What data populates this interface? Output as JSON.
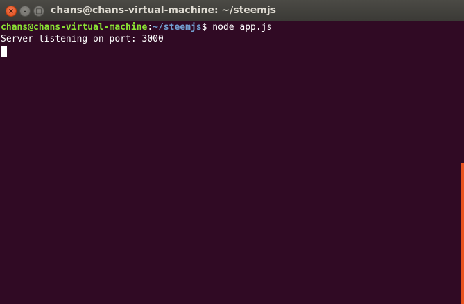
{
  "window": {
    "title": "chans@chans-virtual-machine: ~/steemjs",
    "controls": {
      "close_glyph": "×",
      "minimize_glyph": "–",
      "maximize_glyph": "□"
    }
  },
  "terminal": {
    "prompt": {
      "user_host": "chans@chans-virtual-machine",
      "separator": ":",
      "path": "~/steemjs",
      "symbol": "$",
      "command": " node app.js"
    },
    "output_lines": [
      "Server listening on port: 3000"
    ]
  },
  "colors": {
    "background": "#300a24",
    "user_host": "#8ae234",
    "path": "#729fcf",
    "text": "#ffffff",
    "accent": "#e95420"
  }
}
